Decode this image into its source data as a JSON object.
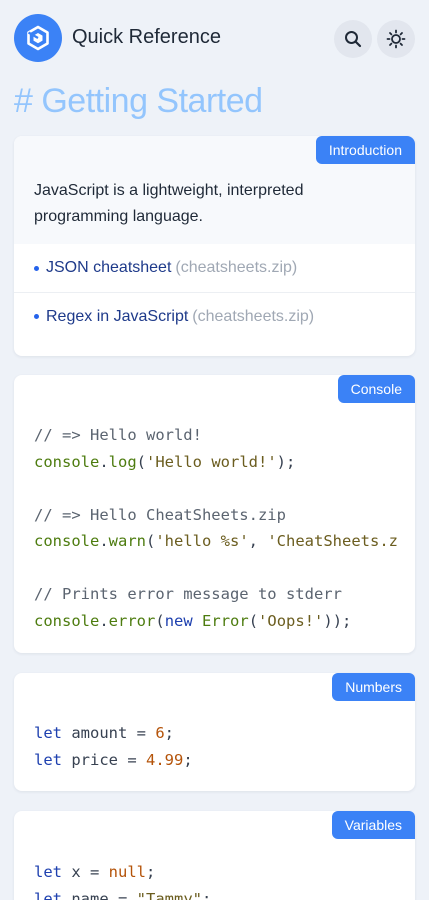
{
  "app": {
    "title": "Quick Reference",
    "accent": "#3b82f6",
    "logo_icon": "cube-logo-icon",
    "search_icon": "search-icon",
    "theme_icon": "sun-icon"
  },
  "page": {
    "heading": "# Getting Started"
  },
  "intro": {
    "tag": "Introduction",
    "description": "JavaScript is a lightweight, interpreted programming language.",
    "links": [
      {
        "label": "JSON cheatsheet",
        "note": "(cheatsheets.zip)"
      },
      {
        "label": "Regex in JavaScript",
        "note": "(cheatsheets.zip)"
      }
    ]
  },
  "console_card": {
    "tag": "Console",
    "comment1": "// => Hello world!",
    "obj1": "console",
    "dot1": ".",
    "method1": "log",
    "open1": "(",
    "str1": "'Hello world!'",
    "close1": ");",
    "comment2": "// => Hello CheatSheets.zip",
    "obj2": "console",
    "dot2": ".",
    "method2": "warn",
    "open2": "(",
    "str2a": "'hello %s'",
    "comma2": ", ",
    "str2b": "'CheatSheets.zip'",
    "close2": ");",
    "comment3": "// Prints error message to stderr",
    "obj3": "console",
    "dot3": ".",
    "method3": "error",
    "open3": "(",
    "kw3": "new",
    "cls3": "Error",
    "open3b": "(",
    "str3": "'Oops!'",
    "close3": "));"
  },
  "numbers_card": {
    "tag": "Numbers",
    "kw1": "let",
    "var1": " amount = ",
    "num1": "6",
    "end1": ";",
    "kw2": "let",
    "var2": " price = ",
    "num2": "4.99",
    "end2": ";"
  },
  "variables_card": {
    "tag": "Variables",
    "kw1": "let",
    "var1": " x = ",
    "val1": "null",
    "end1": ";",
    "kw2": "let",
    "var2": " name = ",
    "val2": "\"Tammy\"",
    "end2": ";"
  }
}
